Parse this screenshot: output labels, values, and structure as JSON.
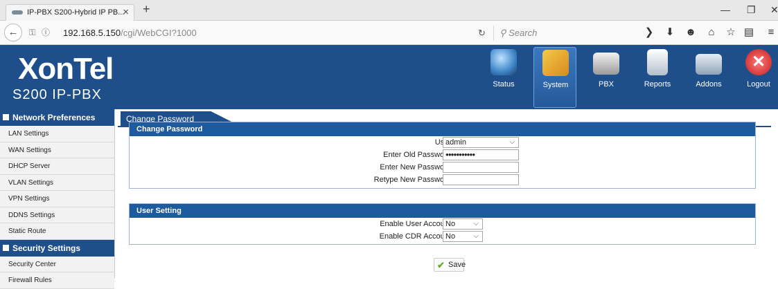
{
  "browser": {
    "tab_title": "IP-PBX S200-Hybrid IP PB...",
    "url_host": "192.168.5.150",
    "url_path": "/cgi/WebCGI?1000",
    "search_placeholder": "Search"
  },
  "header": {
    "logo": "XonTel",
    "logo_sub": "S200 IP-PBX",
    "modules": [
      {
        "label": "Status",
        "icon": "status-icon",
        "color": "#5a9bd4"
      },
      {
        "label": "System",
        "icon": "system-icon",
        "color": "#e0a82a"
      },
      {
        "label": "PBX",
        "icon": "pbx-icon",
        "color": "#d9d9d9"
      },
      {
        "label": "Reports",
        "icon": "reports-icon",
        "color": "#bfc9d4"
      },
      {
        "label": "Addons",
        "icon": "addons-icon",
        "color": "#cfd8e2"
      },
      {
        "label": "Logout",
        "icon": "logout-icon",
        "color": "#d83a3a"
      }
    ],
    "active_module": "System"
  },
  "sidebar": {
    "section1": "Network Preferences",
    "items1": [
      "LAN Settings",
      "WAN Settings",
      "DHCP Server",
      "VLAN Settings",
      "VPN Settings",
      "DDNS Settings",
      "Static Route"
    ],
    "section2": "Security Settings",
    "items2": [
      "Security Center",
      "Firewall Rules"
    ]
  },
  "content": {
    "tab": "Change Password",
    "panel1": {
      "title": "Change Password",
      "user_label": "User:",
      "user_value": "admin",
      "old_label": "Enter Old Password:",
      "old_value": "●●●●●●●●●●●",
      "new_label": "Enter New Password:",
      "retype_label": "Retype New Password:"
    },
    "panel2": {
      "title": "User Setting",
      "enable_user_label": "Enable User Account:",
      "enable_user_value": "No",
      "enable_cdr_label": "Enable CDR Account:",
      "enable_cdr_value": "No"
    },
    "save_label": "Save"
  },
  "colors": {
    "header_bg": "#1e4f8a",
    "panel_head": "#1e5a9e"
  }
}
